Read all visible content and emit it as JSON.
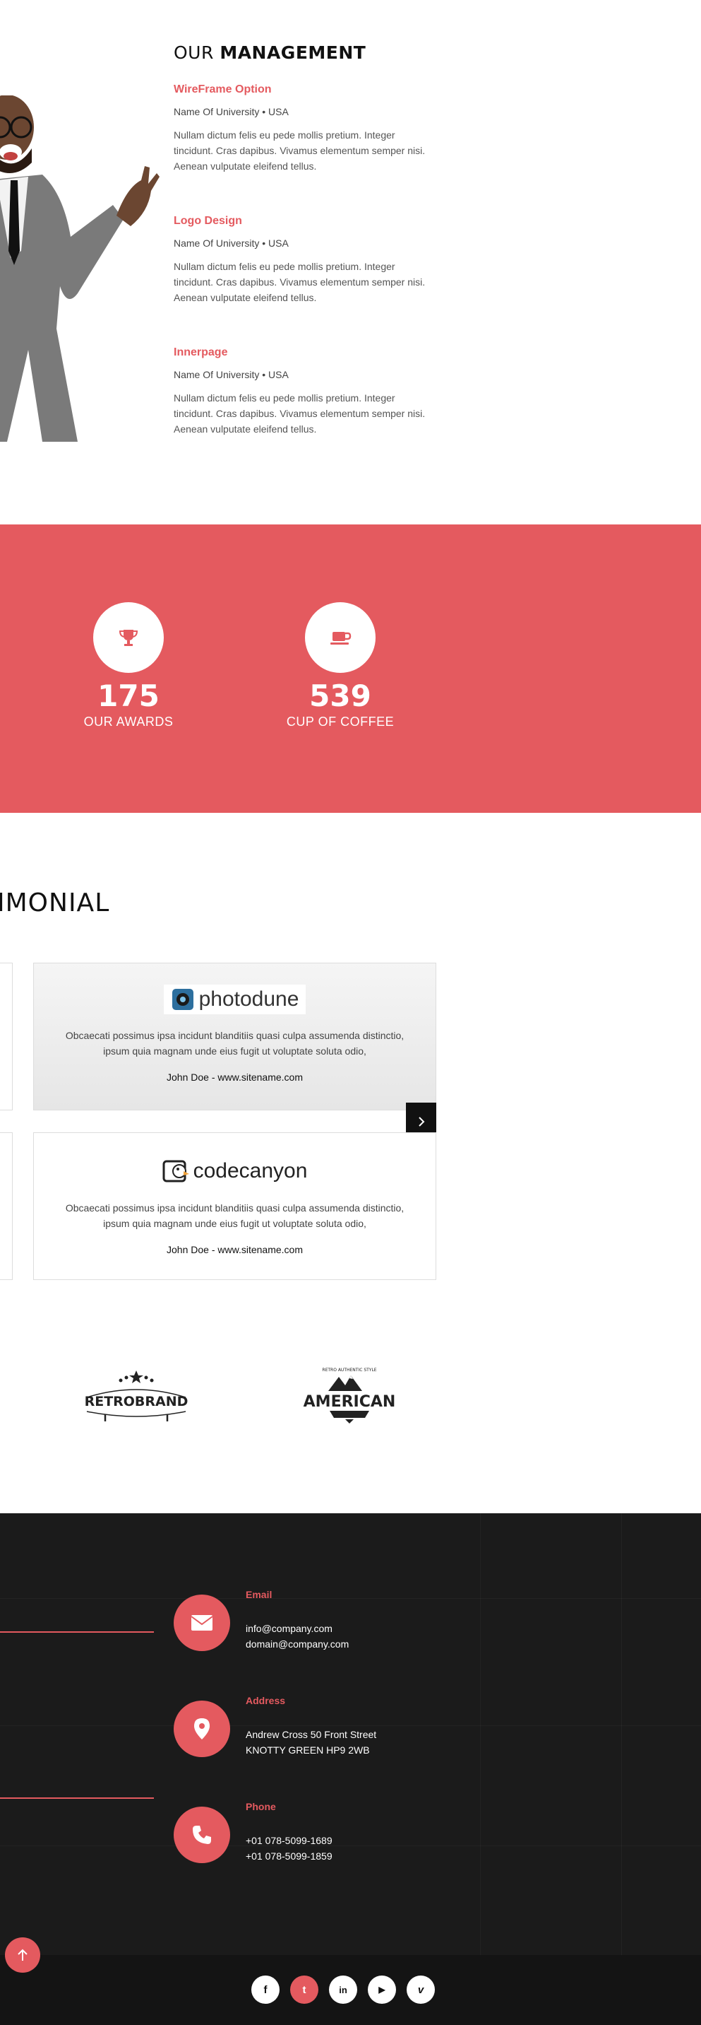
{
  "management": {
    "title_light": "OUR",
    "title_bold": "MANAGEMENT",
    "items": [
      {
        "name": "WireFrame Option",
        "sub": "Name Of University • USA",
        "desc": "Nullam dictum felis eu pede mollis pretium. Integer tincidunt. Cras dapibus. Vivamus elementum semper nisi. Aenean vulputate eleifend tellus."
      },
      {
        "name": "Logo Design",
        "sub": "Name Of University • USA",
        "desc": "Nullam dictum felis eu pede mollis pretium. Integer tincidunt. Cras dapibus. Vivamus elementum semper nisi. Aenean vulputate eleifend tellus."
      },
      {
        "name": "Innerpage",
        "sub": "Name Of University • USA",
        "desc": "Nullam dictum felis eu pede mollis pretium. Integer tincidunt. Cras dapibus. Vivamus elementum semper nisi. Aenean vulputate eleifend tellus."
      }
    ]
  },
  "stats": [
    {
      "icon": "trophy-icon",
      "number": "175",
      "label": "OUR AWARDS"
    },
    {
      "icon": "coffee-cup-icon",
      "number": "539",
      "label": "CUP OF COFFEE"
    }
  ],
  "testimonial": {
    "title": "IMONIAL",
    "cards": [
      {
        "logo_text": "photodune",
        "text": "Obcaecati possimus ipsa incidunt blanditiis quasi culpa assumenda distinctio, ipsum quia magnam unde eius fugit ut voluptate soluta odio,",
        "author": "John Doe - www.sitename.com"
      },
      {
        "logo_text": "codecanyon",
        "text": "Obcaecati possimus ipsa incidunt blanditiis quasi culpa assumenda distinctio, ipsum quia magnam unde eius fugit ut voluptate soluta odio,",
        "author": "John Doe - www.sitename.com"
      }
    ]
  },
  "brands": [
    {
      "name": "RETROBRAND"
    },
    {
      "name": "AMERICAN",
      "tagline": "RETRO AUTHENTIC STYLE"
    }
  ],
  "contact": {
    "email": {
      "label": "Email",
      "line1": "info@company.com",
      "line2": "domain@company.com"
    },
    "address": {
      "label": "Address",
      "line1": "Andrew Cross 50 Front Street",
      "line2": "KNOTTY GREEN HP9 2WB"
    },
    "phone": {
      "label": "Phone",
      "line1": "+01 078-5099-1689",
      "line2": "+01 078-5099-1859"
    }
  },
  "social": [
    {
      "name": "facebook",
      "glyph": "f"
    },
    {
      "name": "twitter",
      "glyph": "t"
    },
    {
      "name": "linkedin",
      "glyph": "in"
    },
    {
      "name": "youtube",
      "glyph": "▶"
    },
    {
      "name": "vimeo",
      "glyph": "v"
    }
  ],
  "colors": {
    "accent": "#e45a5f",
    "dark": "#1b1b1b"
  }
}
